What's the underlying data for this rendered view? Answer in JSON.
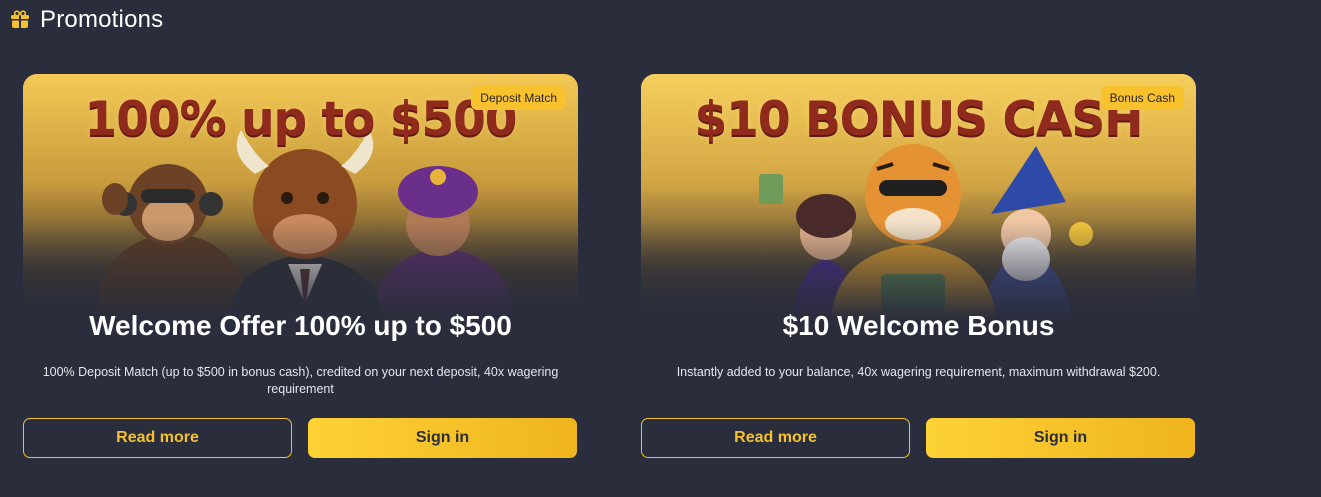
{
  "header": {
    "title": "Promotions",
    "icon": "gift-icon"
  },
  "colors": {
    "background": "#2a2d3b",
    "accent": "#f7c22e",
    "headline": "#8f2a1d"
  },
  "promotions": [
    {
      "badge": "Deposit Match",
      "banner_headline": "100% up to $500",
      "title": "Welcome Offer 100% up to $500",
      "description": "100% Deposit Match (up to $500 in bonus cash), credited on your next deposit, 40x wagering requirement",
      "read_more_label": "Read more",
      "sign_in_label": "Sign in",
      "banner_characters": [
        "monkey-with-headphones",
        "bull-in-suit",
        "genie-with-turban"
      ]
    },
    {
      "badge": "Bonus Cash",
      "banner_headline": "$10 BONUS CASH",
      "title": "$10 Welcome Bonus",
      "description": "Instantly added to your balance, 40x wagering requirement, maximum withdrawal $200.",
      "read_more_label": "Read more",
      "sign_in_label": "Sign in",
      "banner_characters": [
        "woman-with-cash",
        "tiger-with-cash",
        "wizard-with-coins"
      ]
    }
  ]
}
